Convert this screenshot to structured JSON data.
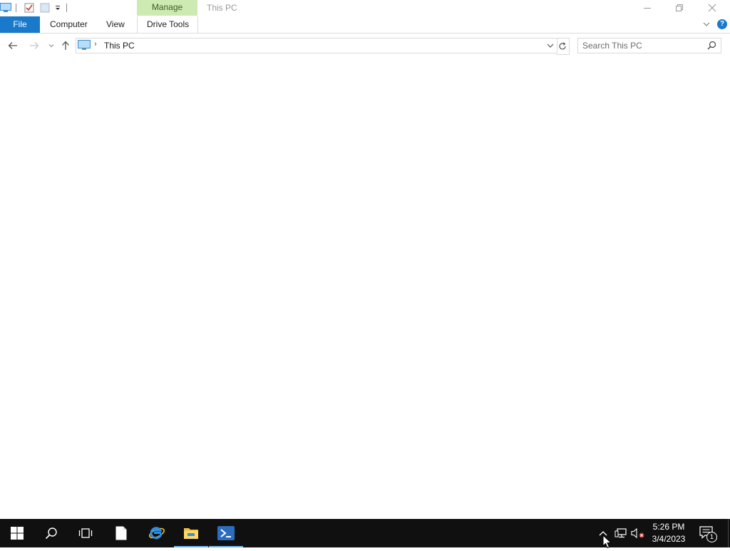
{
  "window": {
    "title": "This PC",
    "contextual_tab_group": "Manage"
  },
  "ribbon": {
    "tabs": [
      {
        "label": "File"
      },
      {
        "label": "Computer"
      },
      {
        "label": "View"
      },
      {
        "label": "Drive Tools"
      }
    ],
    "help_glyph": "?"
  },
  "navigation": {
    "breadcrumb": [
      "This PC"
    ],
    "search_placeholder": "Search This PC"
  },
  "taskbar": {
    "pinned": [
      {
        "name": "start-icon"
      },
      {
        "name": "search-icon"
      },
      {
        "name": "task-view-icon"
      },
      {
        "name": "notepad-icon"
      },
      {
        "name": "internet-explorer-icon"
      },
      {
        "name": "file-explorer-icon"
      },
      {
        "name": "powershell-icon"
      }
    ],
    "clock": {
      "time": "5:26 PM",
      "date": "3/4/2023"
    },
    "notification_count": "1"
  },
  "colors": {
    "file_tab": "#1979ca",
    "manage_tab": "#cdeab2",
    "taskbar": "#101010",
    "active_indicator": "#76b9ed"
  }
}
